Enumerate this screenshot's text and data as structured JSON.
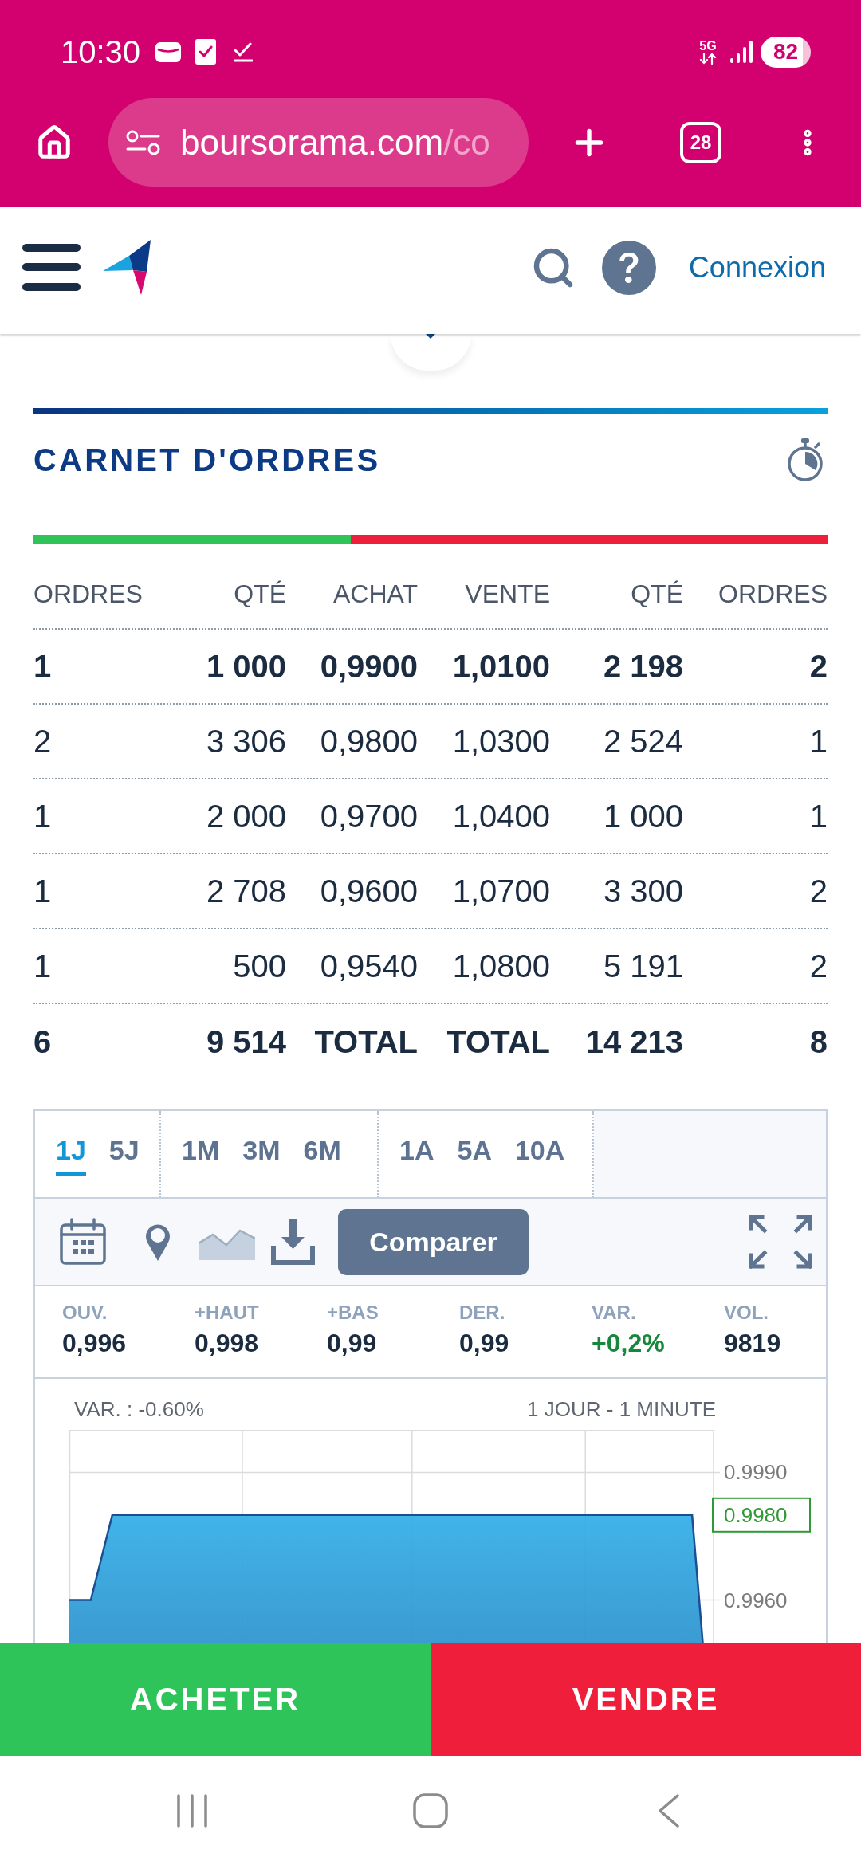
{
  "status_bar": {
    "time": "10:30",
    "network": "5G",
    "battery": "82"
  },
  "browser_bar": {
    "url_host": "boursorama.com",
    "url_path": "/co",
    "tab_count": "28"
  },
  "site_header": {
    "login_link": "Connexion"
  },
  "order_book": {
    "title": "CARNET D'ORDRES",
    "balance": {
      "level": 0.4
    },
    "columns": [
      "ORDRES",
      "QTÉ",
      "ACHAT",
      "VENTE",
      "QTÉ",
      "ORDRES"
    ],
    "rows": [
      {
        "kind": "best",
        "cells": [
          "1",
          "1 000",
          "0,9900",
          "1,0100",
          "2 198",
          "2"
        ]
      },
      {
        "kind": "level",
        "cells": [
          "2",
          "3 306",
          "0,9800",
          "1,0300",
          "2 524",
          "1"
        ]
      },
      {
        "kind": "level",
        "cells": [
          "1",
          "2 000",
          "0,9700",
          "1,0400",
          "1 000",
          "1"
        ]
      },
      {
        "kind": "level",
        "cells": [
          "1",
          "2 708",
          "0,9600",
          "1,0700",
          "3 300",
          "2"
        ]
      },
      {
        "kind": "level",
        "cells": [
          "1",
          "500",
          "0,9540",
          "1,0800",
          "5 191",
          "2"
        ]
      },
      {
        "kind": "total",
        "cells": [
          "6",
          "9 514",
          "TOTAL",
          "TOTAL",
          "14 213",
          "8"
        ]
      }
    ]
  },
  "chart_panel": {
    "period_groups": [
      {
        "periods": [
          {
            "label": "1J",
            "selected": true
          },
          {
            "label": "5J",
            "selected": false
          }
        ]
      },
      {
        "periods": [
          {
            "label": "1M",
            "selected": false
          },
          {
            "label": "3M",
            "selected": false
          },
          {
            "label": "6M",
            "selected": false
          }
        ]
      },
      {
        "periods": [
          {
            "label": "1A",
            "selected": false
          },
          {
            "label": "5A",
            "selected": false
          },
          {
            "label": "10A",
            "selected": false
          }
        ]
      }
    ],
    "compare_button": "Comparer",
    "stats": [
      {
        "label": "OUV.",
        "value": "0,996",
        "kind": "plain"
      },
      {
        "label": "+HAUT",
        "value": "0,998",
        "kind": "plain"
      },
      {
        "label": "+BAS",
        "value": "0,99",
        "kind": "plain"
      },
      {
        "label": "DER.",
        "value": "0,99",
        "kind": "plain"
      },
      {
        "label": "VAR.",
        "value": "+0,2%",
        "kind": "gain"
      },
      {
        "label": "VOL.",
        "value": "9819",
        "kind": "plain"
      }
    ],
    "chart": {
      "variation": "VAR. : -0.60%",
      "interval": "1 JOUR - 1 MINUTE",
      "chart_data": {
        "type": "area",
        "categories": [
          null,
          null,
          null,
          null,
          null,
          null,
          null,
          null,
          null,
          null,
          null,
          null,
          null,
          null,
          null,
          null,
          null,
          null,
          null,
          null,
          null,
          null,
          null,
          null,
          null,
          null,
          null,
          null,
          null,
          null,
          null,
          null,
          null,
          null,
          null,
          null,
          null,
          null,
          null,
          null,
          null,
          null,
          null,
          null,
          null,
          null,
          null,
          null,
          null,
          null,
          null,
          null,
          null,
          null,
          null,
          null,
          null,
          null,
          null,
          null
        ],
        "values": [
          0.996,
          0.996,
          0.996,
          0.997,
          0.998,
          0.998,
          0.998,
          0.998,
          0.998,
          0.998,
          0.998,
          0.998,
          0.998,
          0.998,
          0.998,
          0.998,
          0.998,
          0.998,
          0.998,
          0.998,
          0.998,
          0.998,
          0.998,
          0.998,
          0.998,
          0.998,
          0.998,
          0.998,
          0.998,
          0.998,
          0.998,
          0.998,
          0.998,
          0.998,
          0.998,
          0.998,
          0.998,
          0.998,
          0.998,
          0.998,
          0.998,
          0.998,
          0.998,
          0.998,
          0.998,
          0.998,
          0.998,
          0.998,
          0.998,
          0.998,
          0.998,
          0.998,
          0.998,
          0.998,
          0.998,
          0.998,
          0.998,
          0.998,
          0.998,
          0.995
        ],
        "ylim": [
          0.995,
          1.0
        ],
        "yticks": [
          {
            "value": 0.999,
            "label": "0.9990"
          },
          {
            "value": 0.996,
            "label": "0.9960"
          }
        ],
        "grid": true,
        "annotations": [
          "0.9980"
        ]
      }
    }
  },
  "actions": [
    {
      "label": "ACHETER",
      "kind": "buy"
    },
    {
      "label": "VENDRE",
      "kind": "sell"
    }
  ]
}
